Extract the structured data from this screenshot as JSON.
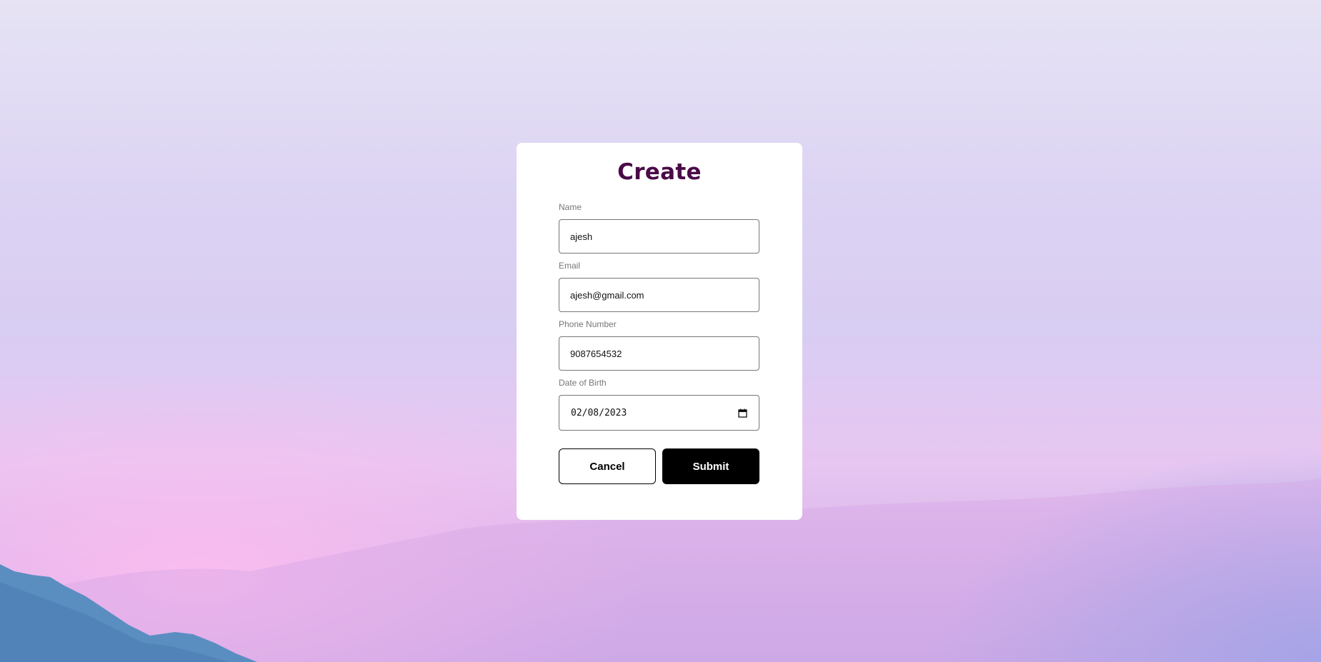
{
  "form": {
    "title": "Create",
    "fields": {
      "name": {
        "label": "Name",
        "value": "ajesh"
      },
      "email": {
        "label": "Email",
        "value": "ajesh@gmail.com"
      },
      "phone": {
        "label": "Phone Number",
        "value": "9087654532"
      },
      "dob": {
        "label": "Date of Birth",
        "value": "02/08/2023"
      }
    },
    "buttons": {
      "cancel_label": "Cancel",
      "submit_label": "Submit"
    }
  },
  "colors": {
    "title": "#4a0a48",
    "submit_bg": "#000000",
    "card_bg": "#ffffff"
  },
  "icons": {
    "date_picker": "calendar-icon"
  }
}
